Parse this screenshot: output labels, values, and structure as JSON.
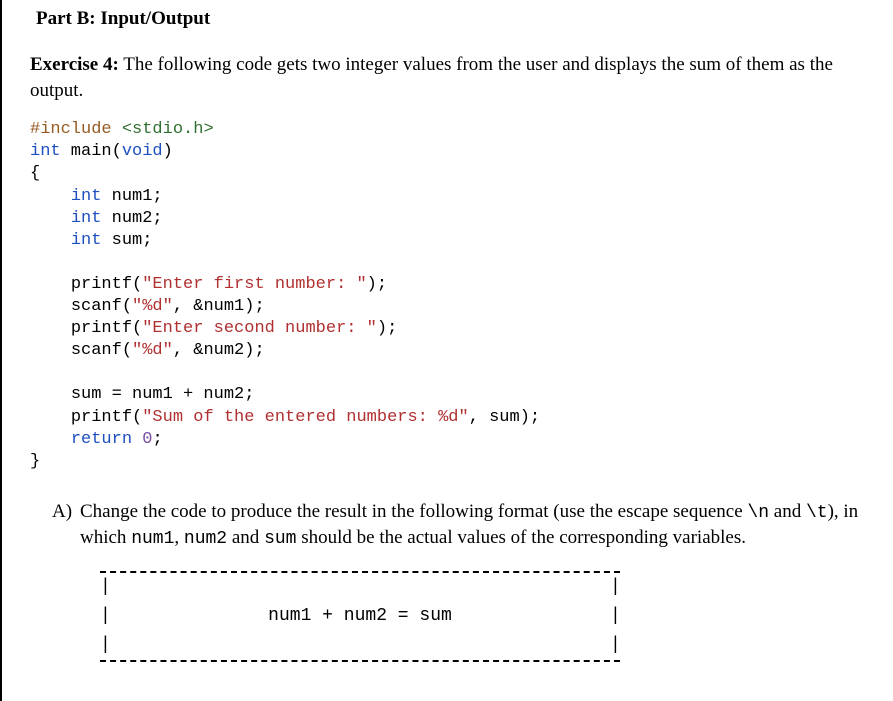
{
  "section_title": "Part B: Input/Output",
  "exercise": {
    "label": "Exercise 4:",
    "text": " The following code gets two integer values from the user and displays the sum of them as the output."
  },
  "code": {
    "pre": "#include",
    "hdr": " <stdio.h>",
    "kw_int": "int",
    "kw_void": "void",
    "kw_return": "return",
    "fn_main": " main(",
    "rp": ")",
    "lb": "{",
    "rb": "}",
    "decl1": " num1;",
    "decl2": " num2;",
    "decl3": " sum;",
    "printf": "printf(",
    "scanf": "scanf(",
    "s_first": "\"Enter first number: \"",
    "s_second": "\"Enter second number: \"",
    "s_fmt": "\"%d\"",
    "s_sum": "\"Sum of the entered numbers: %d\"",
    "arg_n1": ", &num1);",
    "arg_n2": ", &num2);",
    "end_stmt": ");",
    "assign": "sum = num1 + num2;",
    "sum_arg": ", sum);",
    "zero": "0",
    "semicolon": ";",
    "indent": "    "
  },
  "subq": {
    "marker": "A)",
    "text_a": "Change the code to produce the result in the following format (use the escape sequence ",
    "esc1": "\\n",
    "text_b": " and ",
    "esc2": "\\t",
    "text_c": "), in which ",
    "v1": "num1",
    "v2": "num2",
    "v3": "sum",
    "text_d": " should be the actual values of the corresponding variables.",
    "comma": ", ",
    "and": " and "
  },
  "box": {
    "bar": "|",
    "formula": "num1 + num2 = sum"
  }
}
